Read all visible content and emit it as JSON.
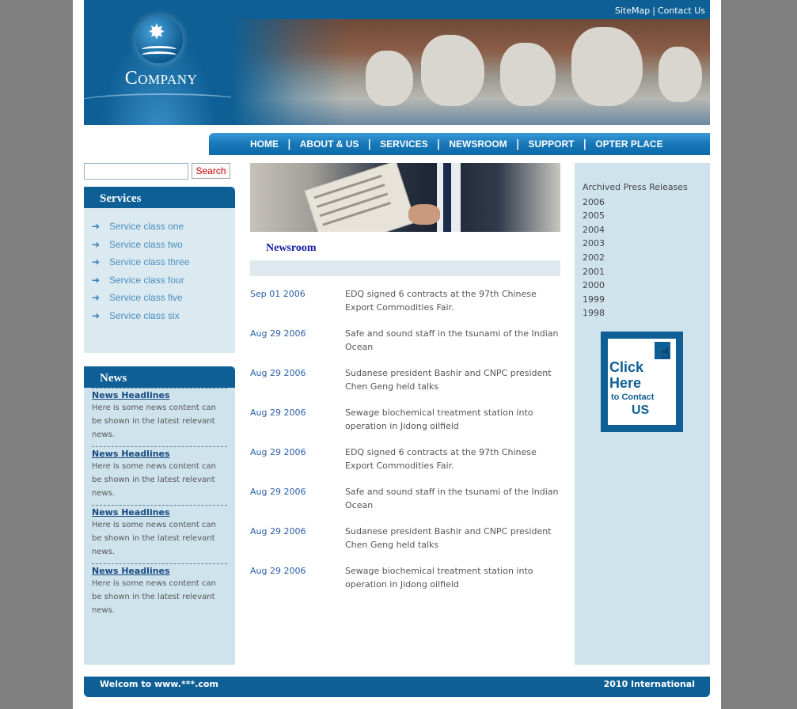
{
  "header": {
    "sitemap": "SiteMap",
    "contact": "Contact Us",
    "sep": "|",
    "logo_text": "Company"
  },
  "nav": {
    "items": [
      "HOME",
      "ABOUT & US",
      "SERVICES",
      "NEWSROOM",
      "SUPPORT",
      "OPTER PLACE"
    ],
    "sep": "|"
  },
  "search": {
    "value": "",
    "button": "Search"
  },
  "services": {
    "title": "Services",
    "items": [
      "Service class one",
      "Service class two",
      "Service class three",
      "Service class four",
      "Service class five",
      "Service class six"
    ]
  },
  "news": {
    "title": "News",
    "items": [
      {
        "headline": "News Headlines",
        "text": "Here is some news content can be shown in the latest relevant news."
      },
      {
        "headline": "News Headlines",
        "text": "Here is some news content can be shown in the latest relevant news."
      },
      {
        "headline": "News Headlines",
        "text": "Here is some news content can be shown in the latest relevant news."
      },
      {
        "headline": "News Headlines",
        "text": "Here is some news content can be shown in the latest relevant news."
      }
    ]
  },
  "newsroom": {
    "title": "Newsroom",
    "rows": [
      {
        "date": "Sep 01 2006",
        "title": "EDQ signed 6 contracts at the 97th Chinese Export Commodities Fair."
      },
      {
        "date": "Aug 29 2006",
        "title": "Safe and sound staff in the tsunami of the Indian Ocean"
      },
      {
        "date": "Aug 29 2006",
        "title": "Sudanese president Bashir and CNPC president Chen Geng held talks"
      },
      {
        "date": "Aug 29 2006",
        "title": "Sewage biochemical treatment station into operation in Jidong oilfield"
      },
      {
        "date": "Aug 29 2006",
        "title": "EDQ signed 6 contracts at the 97th Chinese Export Commodities Fair."
      },
      {
        "date": "Aug 29 2006",
        "title": "Safe and sound staff in the tsunami of the Indian Ocean"
      },
      {
        "date": "Aug 29 2006",
        "title": "Sudanese president Bashir and CNPC president Chen Geng held talks"
      },
      {
        "date": "Aug 29 2006",
        "title": "Sewage biochemical treatment station into operation in Jidong oilfield"
      }
    ]
  },
  "archive": {
    "label": "Archived Press Releases",
    "years": [
      "2006",
      "2005",
      "2004",
      "2003",
      "2002",
      "2001",
      "2000",
      "1999",
      "1998"
    ]
  },
  "contact_banner": {
    "line1": "Click",
    "line2": "Here",
    "line3": "to Contact",
    "line4": "US"
  },
  "footer": {
    "left": "Welcom to www.***.com",
    "right": "2010 International"
  },
  "colors": {
    "brand_blue": "#0d5f95",
    "panel_light": "#cfe3ec",
    "link_blue": "#2a5ea6",
    "newsroom_title": "#1420a3"
  }
}
